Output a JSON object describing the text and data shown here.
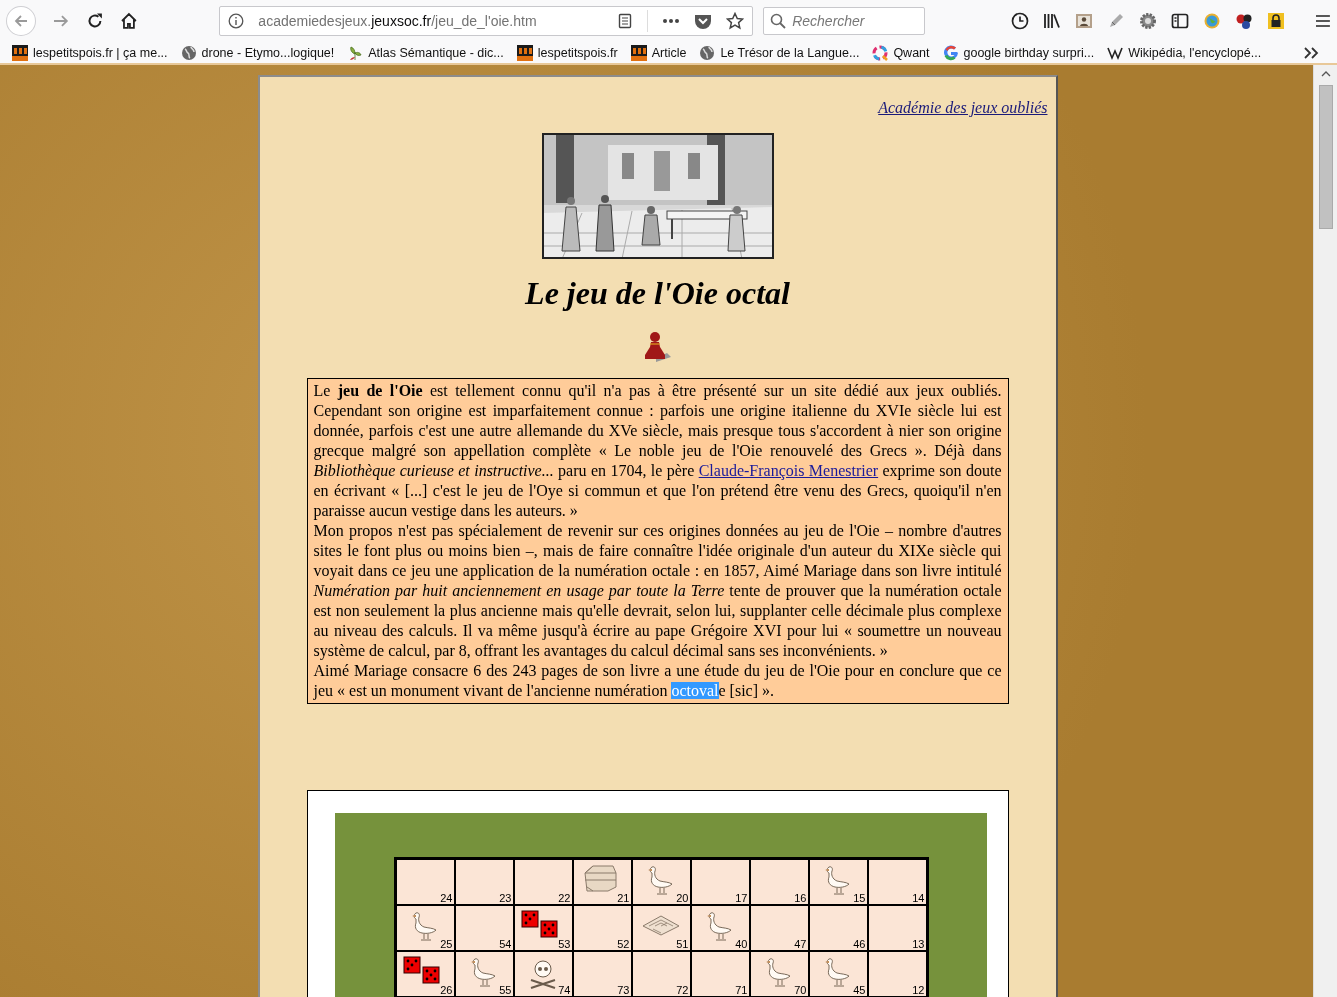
{
  "browser": {
    "address": {
      "prefix": "academiedesjeux.",
      "domain": "jeuxsoc.fr",
      "path": "/jeu_de_l'oie.htm"
    },
    "search": {
      "placeholder": "Rechercher"
    },
    "bookmarks": [
      {
        "label": "lespetitspois.fr | ça me...",
        "kind": "lpp"
      },
      {
        "label": "drone - Etymo...logique!",
        "kind": "globe"
      },
      {
        "label": "Atlas Sémantique - dic...",
        "kind": "atlas"
      },
      {
        "label": "lespetitspois.fr",
        "kind": "lpp"
      },
      {
        "label": "Article",
        "kind": "lpp"
      },
      {
        "label": "Le Trésor de la Langue...",
        "kind": "globe"
      },
      {
        "label": "Qwant",
        "kind": "qwant"
      },
      {
        "label": "google birthday surpri...",
        "kind": "google"
      },
      {
        "label": "Wikipédia, l'encyclopé...",
        "kind": "wiki"
      }
    ]
  },
  "page": {
    "home_link": "Académie des jeux oubliés",
    "title": "Le jeu de l'Oie octal",
    "article": {
      "paragraphs": [
        [
          {
            "kind": "text",
            "text": "Le **jeu de l'Oie** est tellement connu qu'il n'a pas à être présenté sur un site dédié aux jeux oubliés. Cependant son origine est imparfaitement connue : parfois une origine italienne du XVIe siècle lui est donnée, parfois c'est une autre allemande du XVe siècle, mais presque tous s'accordent à nier son origine grecque malgré son appellation complète « Le noble jeu de l'Oie renouvelé des Grecs ». Déjà dans *Bibliothèque curieuse et instructive...* paru en 1704, le père "
          },
          {
            "kind": "link",
            "text": "Claude-François Menestrier"
          },
          {
            "kind": "text",
            "text": " exprime son doute en écrivant « [...] c'est le jeu de l'Oye si commun et que l'on prétend être venu des Grecs, quoiqu'il n'en paraisse aucun vestige dans les auteurs. »"
          }
        ],
        [
          {
            "kind": "text",
            "text": "Mon propos n'est pas spécialement de revenir sur ces origines données au jeu de l'Oie – nombre d'autres sites le font plus ou moins bien –, mais de faire connaître l'idée originale d'un auteur du XIXe siècle qui voyait dans ce jeu une application de la numération octale : en 1857, Aimé Mariage dans son livre intitulé *Numération par huit anciennement en usage par toute la Terre* tente de prouver que la numération octale est non seulement la plus ancienne mais qu'elle devrait, selon lui, supplanter celle décimale plus complexe au niveau des calculs. Il va même jusqu'à écrire au pape Grégoire XVI pour lui « soumettre un nouveau système de calcul, par 8, offrant les avantages du calcul décimal sans ses inconvénients. »"
          }
        ],
        [
          {
            "kind": "text",
            "text": "Aimé Mariage consacre 6 des 243 pages de son livre a une étude du jeu de l'Oie pour en conclure que ce jeu « est un monument vivant de l'ancienne numération "
          },
          {
            "kind": "selection",
            "text": "octoval"
          },
          {
            "kind": "text",
            "text": "e [sic] »."
          }
        ]
      ]
    },
    "board": {
      "rows": [
        [
          {
            "number": "24",
            "kind": "plain"
          },
          {
            "number": "23",
            "kind": "plain"
          },
          {
            "number": "22",
            "kind": "plain"
          },
          {
            "number": "21",
            "kind": "chest"
          },
          {
            "number": "20",
            "kind": "goose"
          },
          {
            "number": "17",
            "kind": "plain"
          },
          {
            "number": "16",
            "kind": "plain"
          },
          {
            "number": "15",
            "kind": "goose"
          },
          {
            "number": "14",
            "kind": "plain"
          }
        ],
        [
          {
            "number": "25",
            "kind": "goose"
          },
          {
            "number": "54",
            "kind": "plain"
          },
          {
            "number": "53",
            "kind": "dice"
          },
          {
            "number": "52",
            "kind": "plain"
          },
          {
            "number": "51",
            "kind": "maze"
          },
          {
            "number": "40",
            "kind": "goose"
          },
          {
            "number": "47",
            "kind": "plain"
          },
          {
            "number": "46",
            "kind": "plain"
          },
          {
            "number": "13",
            "kind": "plain"
          }
        ],
        [
          {
            "number": "26",
            "kind": "dice"
          },
          {
            "number": "55",
            "kind": "goose"
          },
          {
            "number": "74",
            "kind": "skull"
          },
          {
            "number": "73",
            "kind": "plain"
          },
          {
            "number": "72",
            "kind": "plain"
          },
          {
            "number": "71",
            "kind": "plain"
          },
          {
            "number": "70",
            "kind": "goose"
          },
          {
            "number": "45",
            "kind": "goose"
          },
          {
            "number": "12",
            "kind": "plain"
          }
        ]
      ]
    }
  }
}
